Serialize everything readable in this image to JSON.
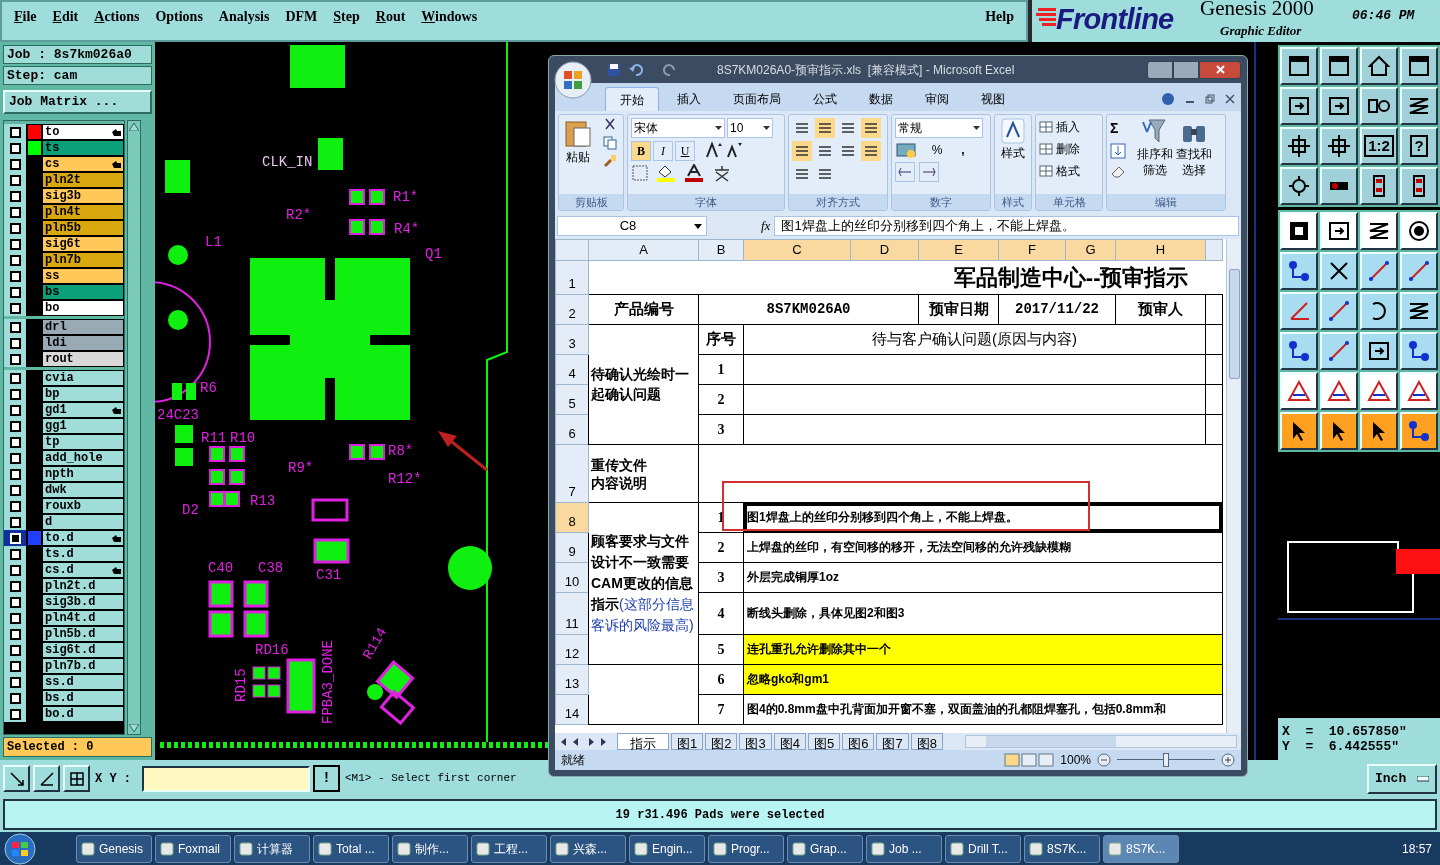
{
  "menu": {
    "items": [
      {
        "label": "File",
        "mnemonic": true
      },
      {
        "label": "Edit",
        "mnemonic": true
      },
      {
        "label": "Actions",
        "mnemonic": true
      },
      {
        "label": "Options",
        "mnemonic": false
      },
      {
        "label": "Analysis",
        "mnemonic": false
      },
      {
        "label": "DFM",
        "mnemonic": false
      },
      {
        "label": "Step",
        "mnemonic": true
      },
      {
        "label": "Rout",
        "mnemonic": true
      },
      {
        "label": "Windows",
        "mnemonic": true
      }
    ],
    "help": "Help"
  },
  "header": {
    "logo": "Frontline",
    "product": "Genesis 2000",
    "time": "06:46 PM",
    "subtitle": "Graphic Editor"
  },
  "job_panel": {
    "job": "Job : 8s7km026a0",
    "step": "Step: cam",
    "matrix_button": "Job Matrix ...",
    "selected_count": "Selected : 0"
  },
  "layer_groups": [
    [
      {
        "name": "to",
        "kind": "silk_screen",
        "color": "#ff0000",
        "marked": true,
        "selected": false
      },
      {
        "name": "ts",
        "kind": "solder_mask",
        "color": "#00ff00",
        "marked": false,
        "selected": false
      },
      {
        "name": "cs",
        "kind": "signal",
        "marked": true,
        "selected": false
      },
      {
        "name": "pln2t",
        "kind": "power_ground",
        "marked": false,
        "selected": false
      },
      {
        "name": "sig3b",
        "kind": "signal",
        "marked": false,
        "selected": false
      },
      {
        "name": "pln4t",
        "kind": "power_ground",
        "marked": false,
        "selected": false
      },
      {
        "name": "pln5b",
        "kind": "power_ground",
        "marked": false,
        "selected": false
      },
      {
        "name": "sig6t",
        "kind": "signal",
        "marked": false,
        "selected": false
      },
      {
        "name": "pln7b",
        "kind": "power_ground",
        "marked": false,
        "selected": false
      },
      {
        "name": "ss",
        "kind": "signal",
        "marked": false,
        "selected": false
      },
      {
        "name": "bs",
        "kind": "solder_mask",
        "marked": false,
        "selected": false
      },
      {
        "name": "bo",
        "kind": "silk_screen",
        "marked": false,
        "selected": false
      }
    ],
    [
      {
        "name": "drl",
        "kind": "drill",
        "marked": false,
        "selected": false
      },
      {
        "name": "ldi",
        "kind": "drill",
        "marked": false,
        "selected": false
      },
      {
        "name": "rout",
        "kind": "rout",
        "marked": false,
        "selected": false
      }
    ],
    [
      {
        "name": "cvia",
        "kind": "document",
        "marked": false,
        "selected": false
      },
      {
        "name": "bp",
        "kind": "document",
        "marked": false,
        "selected": false
      },
      {
        "name": "gd1",
        "kind": "document",
        "marked": true,
        "selected": false
      },
      {
        "name": "gg1",
        "kind": "document",
        "marked": false,
        "selected": false
      },
      {
        "name": "tp",
        "kind": "document",
        "marked": false,
        "selected": false
      },
      {
        "name": "add_hole",
        "kind": "document",
        "marked": false,
        "selected": false
      },
      {
        "name": "npth",
        "kind": "document",
        "marked": false,
        "selected": false
      },
      {
        "name": "dwk",
        "kind": "document",
        "marked": false,
        "selected": false
      },
      {
        "name": "rouxb",
        "kind": "document",
        "marked": false,
        "selected": false
      },
      {
        "name": "d",
        "kind": "document",
        "marked": false,
        "selected": false
      },
      {
        "name": "to.d",
        "kind": "document",
        "color": "#2040ff",
        "marked": true,
        "selected": true
      },
      {
        "name": "ts.d",
        "kind": "document",
        "marked": false,
        "selected": false
      },
      {
        "name": "cs.d",
        "kind": "document",
        "marked": true,
        "selected": false
      },
      {
        "name": "pln2t.d",
        "kind": "document",
        "marked": false,
        "selected": false
      },
      {
        "name": "sig3b.d",
        "kind": "document",
        "marked": false,
        "selected": false
      },
      {
        "name": "pln4t.d",
        "kind": "document",
        "marked": false,
        "selected": false
      },
      {
        "name": "pln5b.d",
        "kind": "document",
        "marked": false,
        "selected": false
      },
      {
        "name": "sig6t.d",
        "kind": "document",
        "marked": false,
        "selected": false
      },
      {
        "name": "pln7b.d",
        "kind": "document",
        "marked": false,
        "selected": false
      },
      {
        "name": "ss.d",
        "kind": "document",
        "marked": false,
        "selected": false
      },
      {
        "name": "bs.d",
        "kind": "document",
        "marked": false,
        "selected": false
      },
      {
        "name": "bo.d",
        "kind": "document",
        "marked": false,
        "selected": false
      }
    ]
  ],
  "canvas": {
    "labels": [
      "CLK_IN",
      "R1*",
      "R2*",
      "R4*",
      "Q1",
      "L1",
      "R6",
      "24C23",
      "R11",
      "R10",
      "R8*",
      "R9*",
      "R12*",
      "R13",
      "D2",
      "C40",
      "C38",
      "C31",
      "RD16",
      "RD15",
      "FPBA3_DONE",
      "R114"
    ]
  },
  "tools": [
    {
      "kind": "window"
    },
    {
      "kind": "window"
    },
    {
      "kind": "home"
    },
    {
      "kind": "window"
    },
    {
      "kind": "frame"
    },
    {
      "kind": "frame"
    },
    {
      "kind": "pair"
    },
    {
      "kind": "zigzag"
    },
    {
      "kind": "expand"
    },
    {
      "kind": "expand"
    },
    {
      "kind": "text",
      "label": "1:2"
    },
    {
      "kind": "text",
      "label": "?"
    },
    {
      "kind": "gear"
    },
    {
      "kind": "pin"
    },
    {
      "kind": "stack"
    },
    {
      "kind": "stack"
    },
    {
      "kind": "square"
    },
    {
      "kind": "frame"
    },
    {
      "kind": "zigzag"
    },
    {
      "kind": "target"
    },
    {
      "kind": "node"
    },
    {
      "kind": "cross"
    },
    {
      "kind": "line"
    },
    {
      "kind": "line"
    },
    {
      "kind": "angle"
    },
    {
      "kind": "line"
    },
    {
      "kind": "arc"
    },
    {
      "kind": "zigzag"
    },
    {
      "kind": "node"
    },
    {
      "kind": "line"
    },
    {
      "kind": "frame"
    },
    {
      "kind": "node"
    },
    {
      "kind": "triangle"
    },
    {
      "kind": "triangle"
    },
    {
      "kind": "triangle"
    },
    {
      "kind": "triangle"
    },
    {
      "kind": "cursor"
    },
    {
      "kind": "cursor"
    },
    {
      "kind": "cursor"
    },
    {
      "kind": "node"
    }
  ],
  "coordinates": {
    "x": "X  =  10.657850\"",
    "y": "Y  =  6.442555\""
  },
  "excel": {
    "title": "8S7KM026A0-预审指示.xls  [兼容模式] - Microsoft Excel",
    "tabs": [
      {
        "label": "开始",
        "selected": true
      },
      {
        "label": "插入",
        "selected": false
      },
      {
        "label": "页面布局",
        "selected": false
      },
      {
        "label": "公式",
        "selected": false
      },
      {
        "label": "数据",
        "selected": false
      },
      {
        "label": "审阅",
        "selected": false
      },
      {
        "label": "视图",
        "selected": false
      }
    ],
    "groups": [
      "剪贴板",
      "字体",
      "对齐方式",
      "数字",
      "样式",
      "单元格",
      "编辑"
    ],
    "paste": "粘贴",
    "font_name": "宋体",
    "font_size": "10",
    "font_buttons": [
      "B",
      "I",
      "U"
    ],
    "number_format": "常规",
    "percent": "%",
    "comma": ",",
    "styles": "样式",
    "cell_buttons": [
      "插入",
      "删除",
      "格式"
    ],
    "autosum": "Σ",
    "sort": [
      "排序和",
      "筛选"
    ],
    "find": [
      "查找和",
      "选择"
    ],
    "name_box": "C8",
    "fx": "fx",
    "formula": "图1焊盘上的丝印分别移到四个角上，不能上焊盘。",
    "columns": [
      {
        "label": "A",
        "selected": false
      },
      {
        "label": "B",
        "selected": false
      },
      {
        "label": "C",
        "selected": true
      },
      {
        "label": "D",
        "selected": true
      },
      {
        "label": "E",
        "selected": true
      },
      {
        "label": "F",
        "selected": true
      },
      {
        "label": "G",
        "selected": true
      },
      {
        "label": "H",
        "selected": true
      }
    ],
    "rows": [
      {
        "label": "1",
        "selected": false
      },
      {
        "label": "2",
        "selected": false
      },
      {
        "label": "3",
        "selected": false
      },
      {
        "label": "4",
        "selected": false
      },
      {
        "label": "5",
        "selected": false
      },
      {
        "label": "6",
        "selected": false
      },
      {
        "label": "7",
        "selected": false
      },
      {
        "label": "8",
        "selected": true
      },
      {
        "label": "9",
        "selected": false
      },
      {
        "label": "10",
        "selected": false
      },
      {
        "label": "11",
        "selected": false
      },
      {
        "label": "12",
        "selected": false
      },
      {
        "label": "13",
        "selected": false
      },
      {
        "label": "14",
        "selected": false
      }
    ],
    "sheet": {
      "title": "军品制造中心--预审指示",
      "product_label": "产品编号",
      "product_no": "8S7KM026A0",
      "date_label": "预审日期",
      "date": "2017/11/22",
      "reviewer_label": "预审人",
      "confirm_label": "待确认光绘时一起确认问题",
      "no_header": "序号",
      "issue_header": "待与客户确认问题(原因与内容)",
      "confirm_rows": [
        "1",
        "2",
        "3"
      ],
      "reupload_label": [
        "重传文件",
        "内容说明"
      ],
      "changes_label": "顾客要求与文件设计不一致需要CAM更改的信息指示",
      "changes_note": "(这部分信息客诉的风险最高)",
      "items": [
        {
          "no": "1",
          "text": "图1焊盘上的丝印分别移到四个角上，不能上焊盘。",
          "highlighted": false,
          "selected": true
        },
        {
          "no": "2",
          "text": "上焊盘的丝印，有空间移的移开，无法空间移的允许残缺模糊",
          "highlighted": false,
          "selected": false
        },
        {
          "no": "3",
          "text": "外层完成铜厚1oz",
          "highlighted": false,
          "selected": false
        },
        {
          "no": "4",
          "text": "断线头删除，具体见图2和图3",
          "highlighted": false,
          "selected": false
        },
        {
          "no": "5",
          "text": "连孔重孔允许删除其中一个",
          "highlighted": true,
          "selected": false
        },
        {
          "no": "6",
          "text": "忽略gko和gm1",
          "highlighted": true,
          "selected": false
        },
        {
          "no": "7",
          "text": "图4的0.8mm盘中孔背面加开窗不塞，双面盖油的孔都阻焊塞孔，包括0.8mm和",
          "highlighted": false,
          "selected": false
        }
      ]
    },
    "sheet_tabs": [
      {
        "label": "指示",
        "selected": true
      },
      {
        "label": "图1",
        "selected": false
      },
      {
        "label": "图2",
        "selected": false
      },
      {
        "label": "图3",
        "selected": false
      },
      {
        "label": "图4",
        "selected": false
      },
      {
        "label": "图5",
        "selected": false
      },
      {
        "label": "图6",
        "selected": false
      },
      {
        "label": "图7",
        "selected": false
      },
      {
        "label": "图8",
        "selected": false
      }
    ],
    "status": "就绪",
    "zoom": "100%",
    "zoom_slider": {
      "level": 0.5
    }
  },
  "command_bar": {
    "xy_label": "X Y :",
    "exclaim": "!",
    "prompt": "<M1> - Select first corner",
    "units": "Inch"
  },
  "status": "19 r31.496 Pads were selected",
  "taskbar": {
    "items": [
      {
        "label": "Genesis",
        "selected": false
      },
      {
        "label": "Foxmail",
        "selected": false
      },
      {
        "label": "计算器",
        "selected": false
      },
      {
        "label": "Total ...",
        "selected": false
      },
      {
        "label": "制作...",
        "selected": false
      },
      {
        "label": "工程...",
        "selected": false
      },
      {
        "label": "兴森...",
        "selected": false
      },
      {
        "label": "Engin...",
        "selected": false
      },
      {
        "label": "Progr...",
        "selected": false
      },
      {
        "label": "Grap...",
        "selected": false
      },
      {
        "label": "Job ...",
        "selected": false
      },
      {
        "label": "Drill T...",
        "selected": false
      },
      {
        "label": "8S7K...",
        "selected": false
      },
      {
        "label": "8S7K...",
        "selected": true
      }
    ],
    "clock": "18:57"
  }
}
